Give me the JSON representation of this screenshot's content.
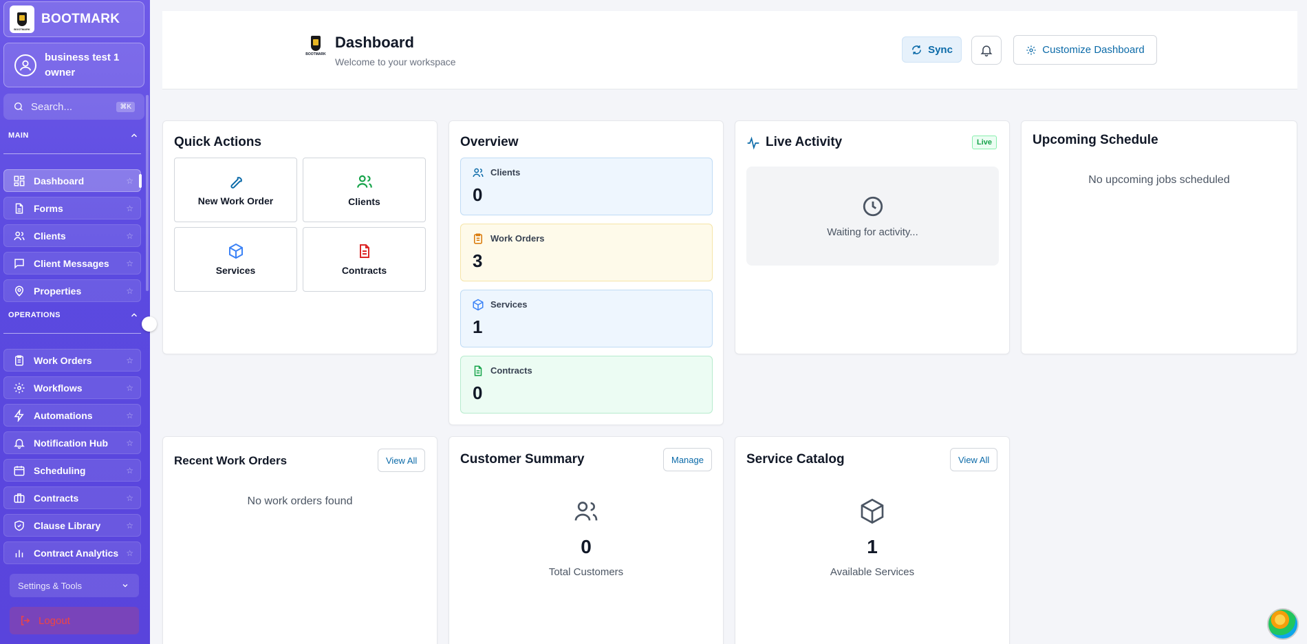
{
  "brand": {
    "name": "BOOTMARK",
    "logo_text": "BOOTMARK"
  },
  "user": {
    "name": "business test 1",
    "role": "owner"
  },
  "search": {
    "placeholder": "Search...",
    "shortcut": "⌘K"
  },
  "sidebar": {
    "main_label": "MAIN",
    "main_items": [
      {
        "label": "Dashboard",
        "icon": "grid-icon",
        "active": true
      },
      {
        "label": "Forms",
        "icon": "file-icon"
      },
      {
        "label": "Clients",
        "icon": "users-icon"
      },
      {
        "label": "Client Messages",
        "icon": "message-icon"
      },
      {
        "label": "Properties",
        "icon": "map-pin-icon"
      }
    ],
    "operations_label": "OPERATIONS",
    "operations_items": [
      {
        "label": "Work Orders",
        "icon": "clipboard-icon"
      },
      {
        "label": "Workflows",
        "icon": "gear-icon"
      },
      {
        "label": "Automations",
        "icon": "bolt-icon"
      },
      {
        "label": "Notification Hub",
        "icon": "bell-icon"
      },
      {
        "label": "Scheduling",
        "icon": "calendar-icon"
      },
      {
        "label": "Contracts",
        "icon": "briefcase-icon"
      },
      {
        "label": "Clause Library",
        "icon": "shield-icon"
      },
      {
        "label": "Contract Analytics",
        "icon": "bar-chart-icon"
      }
    ],
    "settings_label": "Settings & Tools",
    "logout_label": "Logout"
  },
  "header": {
    "title": "Dashboard",
    "subtitle": "Welcome to your workspace",
    "sync_label": "Sync",
    "customize_label": "Customize Dashboard"
  },
  "quick_actions": {
    "title": "Quick Actions",
    "items": [
      {
        "label": "New Work Order",
        "icon": "wrench-icon",
        "color": "#0b6aa8"
      },
      {
        "label": "Clients",
        "icon": "users-icon",
        "color": "#16a34a"
      },
      {
        "label": "Services",
        "icon": "package-icon",
        "color": "#3b82f6"
      },
      {
        "label": "Contracts",
        "icon": "document-icon",
        "color": "#dc2626"
      }
    ]
  },
  "overview": {
    "title": "Overview",
    "items": [
      {
        "label": "Clients",
        "value": "0",
        "icon": "users-icon",
        "bg": "#eef6fe",
        "border": "#bfdbf5",
        "color": "#0b6aa8"
      },
      {
        "label": "Work Orders",
        "value": "3",
        "icon": "clipboard-icon",
        "bg": "#fefaea",
        "border": "#f5e4a8",
        "color": "#d97706"
      },
      {
        "label": "Services",
        "value": "1",
        "icon": "package-icon",
        "bg": "#eef6fe",
        "border": "#bfdbf5",
        "color": "#3b82f6"
      },
      {
        "label": "Contracts",
        "value": "0",
        "icon": "document-icon",
        "bg": "#ecfcf3",
        "border": "#b6ebcd",
        "color": "#16a34a"
      }
    ]
  },
  "live_activity": {
    "title": "Live Activity",
    "badge": "Live",
    "waiting": "Waiting for activity..."
  },
  "upcoming": {
    "title": "Upcoming Schedule",
    "empty": "No upcoming jobs scheduled"
  },
  "recent_orders": {
    "title": "Recent Work Orders",
    "button": "View All",
    "empty": "No work orders found"
  },
  "customer_summary": {
    "title": "Customer Summary",
    "button": "Manage",
    "value": "0",
    "caption": "Total Customers"
  },
  "service_catalog": {
    "title": "Service Catalog",
    "button": "View All",
    "value": "1",
    "caption": "Available Services"
  }
}
